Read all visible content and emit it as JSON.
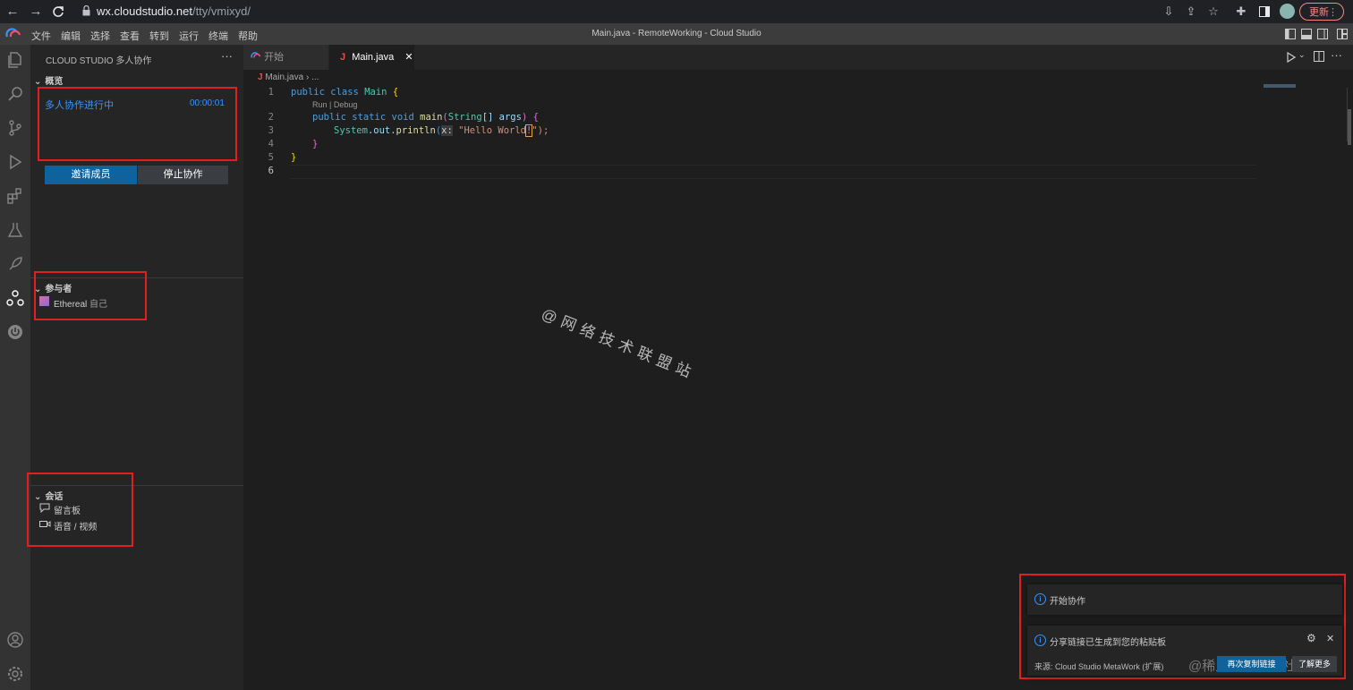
{
  "browser": {
    "url_host": "wx.cloudstudio.net",
    "url_path": "/tty/vmixyd/",
    "update_label": "更新"
  },
  "menu": [
    "文件",
    "编辑",
    "选择",
    "查看",
    "转到",
    "运行",
    "终端",
    "帮助"
  ],
  "window_title": "Main.java - RemoteWorking - Cloud Studio",
  "sidebar": {
    "title": "CLOUD STUDIO 多人协作",
    "overview": {
      "header": "概览",
      "status": "多人协作进行中",
      "timer": "00:00:01",
      "invite_label": "邀请成员",
      "stop_label": "停止协作"
    },
    "participants": {
      "header": "参与者",
      "name": "Ethereal",
      "self_tag": "自己"
    },
    "session": {
      "header": "会话",
      "items": [
        "留言板",
        "语音 / 视频"
      ]
    }
  },
  "tabs": {
    "start_label": "开始",
    "active_label": "Main.java"
  },
  "breadcrumb": {
    "file": "Main.java",
    "rest": "..."
  },
  "code": {
    "line_numbers": [
      "1",
      "2",
      "3",
      "4",
      "5",
      "6"
    ],
    "codelens": "Run | Debug",
    "l1_kw": "public class",
    "l1_name": "Main",
    "l1_brace": "{",
    "l2_kw": "public static void",
    "l2_fn": "main",
    "l2_type": "String",
    "l2_rest": "[] args",
    "l2_open": ") {",
    "l3_sys": "System",
    "l3_out": ".out.",
    "l3_fn": "println",
    "l3_hint": "x:",
    "l3_str": "\"Hello World",
    "l3_cursor": "!",
    "l3_tail": "\");",
    "l4": "}",
    "l5": "}"
  },
  "watermark": "@网络技术联盟站",
  "notifications": {
    "first_text": "开始协作",
    "second_text": "分享链接已生成到您的粘贴板",
    "source": "来源: Cloud Studio MetaWork (扩展)",
    "copy_label": "再次复制链接",
    "learn_label": "了解更多",
    "overlay_watermark": "@稀土掘金技术社区"
  },
  "colors": {
    "accent_blue": "#3794ff",
    "button_primary": "#0e639c",
    "highlight_red": "#e02020"
  }
}
